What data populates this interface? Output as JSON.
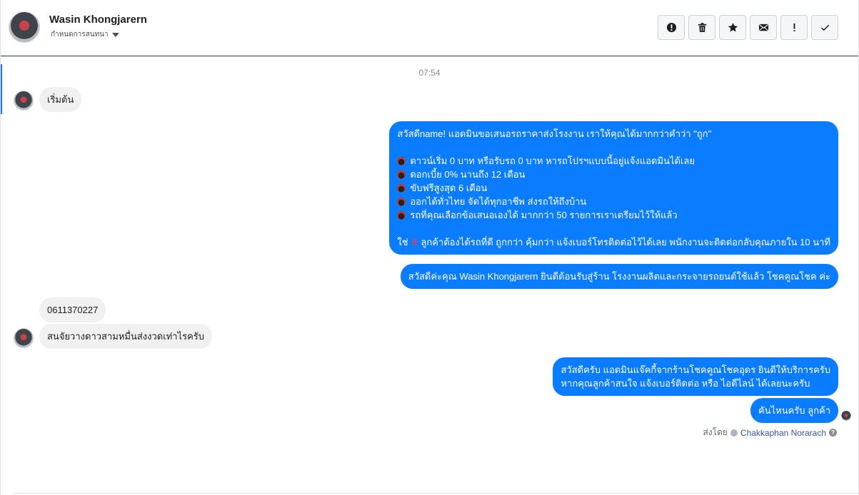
{
  "header": {
    "name": "Wasin Khongjarern",
    "subtitle": "กำหนดการสนทนา",
    "actions": [
      {
        "id": "spam",
        "icon": "alert-circle-icon"
      },
      {
        "id": "delete",
        "icon": "trash-icon"
      },
      {
        "id": "star",
        "icon": "star-icon"
      },
      {
        "id": "mail",
        "icon": "envelope-icon"
      },
      {
        "id": "important",
        "icon": "exclamation-icon"
      },
      {
        "id": "done",
        "icon": "check-icon"
      }
    ]
  },
  "conversation": {
    "timestamp": "07:54",
    "messages": [
      {
        "from": "customer",
        "text": "เริ่มต้น"
      },
      {
        "from": "page",
        "intro": "สวัสดีname! แอดมินขอเสนอรถราคาส่งโรงงาน เราให้คุณได้มากกว่าคำว่า \"ถูก\"",
        "items": [
          "ดาวน์เริ่ม 0 บาท หรือรับรถ 0 บาท หารถโปรฯแบบนี้อยู่แจ้งแอดมินได้เลย",
          "ดอกเบี้ย 0% นานถึง 12 เดือน",
          "ขับฟรีสูงสุด 6 เดือน",
          "ออกได้ทั่วไทย จัดได้ทุกอาชีพ ส่งรถให้ถึงบ้าน",
          "รถที่คุณเลือกข้อเสนอเองได้ มากกว่า 50 รายการเราเตรียมไว้ให้แล้ว"
        ],
        "footer_prefix": "ใช่",
        "footer_suffix": "ลูกค้าต้องได้รถที่ดี ถูกกว่า คุ้มกว่า แจ้งเบอร์โทรติดต่อไว้ได้เลย พนักงานจะติดต่อกลับคุณภายใน 10 นาที"
      },
      {
        "from": "page",
        "text": "สวัสดีค่ะคุณ Wasin Khongjarern ยินดีต้อนรับสู่ร้าน โรงงานผลิตและกระจายรถยนต์ใช้แล้ว โชคคูณโชค ค่ะ"
      },
      {
        "from": "customer",
        "text": "0611370227"
      },
      {
        "from": "customer",
        "text": "สนจัยวางดาวสามหมื่นส่งงวดเท่าไรครับ"
      },
      {
        "from": "page",
        "line1": "สวัสดีครับ แอดมินแจ๊คกี้จากร้านโชคคูณโชคอุดร ยินดีให้บริการครับ",
        "line2": "หากคุณลูกค้าสนใจ แจ้งเบอร์ติดต่อ หรือ ไอดีไลน์ ได้เลยนะครับ"
      },
      {
        "from": "page",
        "text": "คันไหนครับ ลูกค้า"
      }
    ],
    "sent_by_label": "ส่งโดย",
    "sent_by_name": "Chakkaphan Norarach",
    "help_glyph": "?"
  }
}
